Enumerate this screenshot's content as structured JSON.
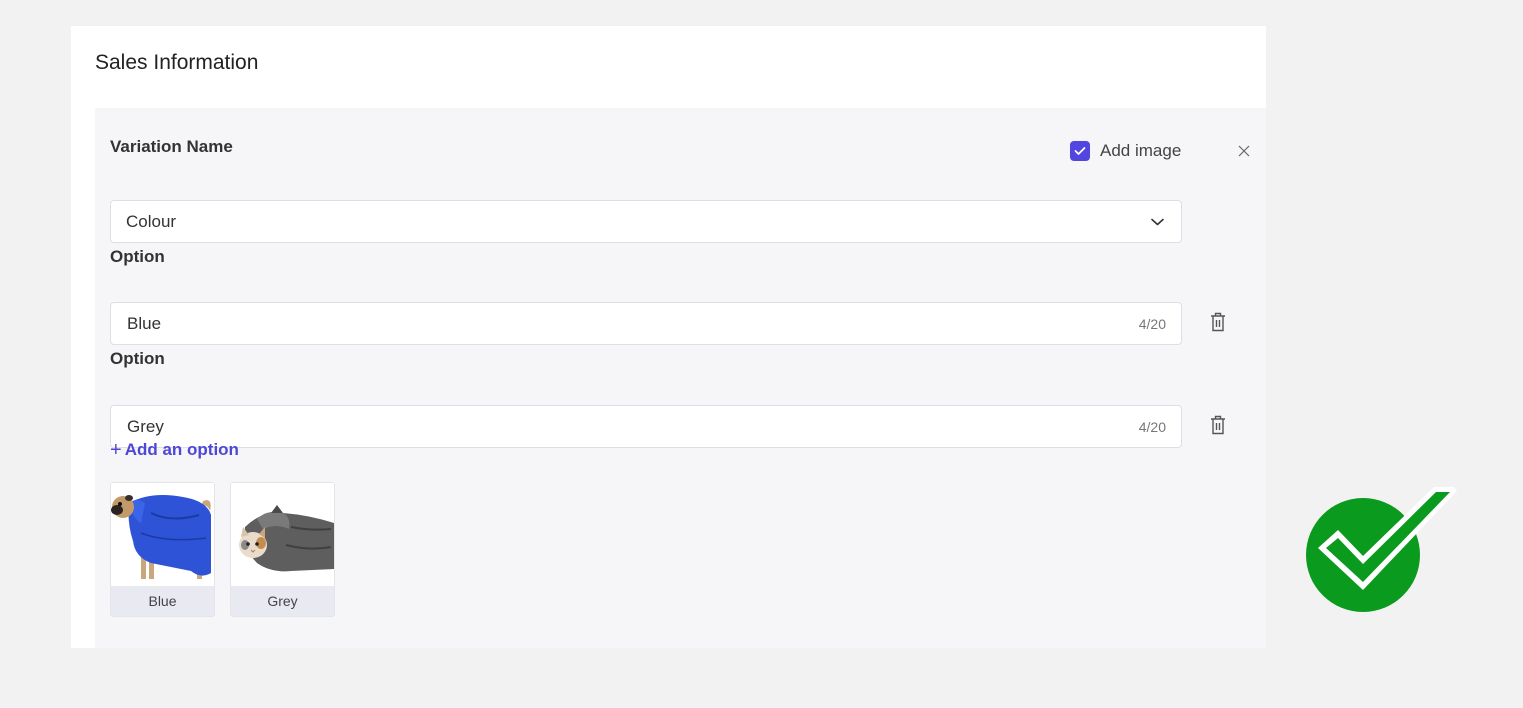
{
  "section": {
    "title": "Sales Information"
  },
  "variation": {
    "name_label": "Variation Name",
    "name_value": "Colour",
    "add_image_label": "Add image",
    "add_image_checked": true
  },
  "options": [
    {
      "label": "Option",
      "value": "Blue",
      "count": "4/20"
    },
    {
      "label": "Option",
      "value": "Grey",
      "count": "4/20"
    }
  ],
  "add_option": {
    "plus": "+",
    "label": "Add an option"
  },
  "images": [
    {
      "caption": "Blue",
      "subject": "pug in blue towel robe"
    },
    {
      "caption": "Grey",
      "subject": "cat in grey towel robe"
    }
  ],
  "icons": {
    "checkbox": "check-icon",
    "close": "close-icon",
    "dropdown": "chevron-down-icon",
    "delete": "trash-icon",
    "badge": "green-checkmark-icon"
  },
  "colors": {
    "accent": "#5146e0",
    "badge_green": "#0a9a1e"
  }
}
